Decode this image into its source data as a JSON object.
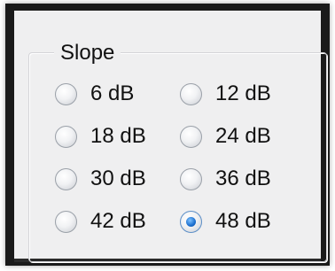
{
  "groupbox": {
    "title": "Slope"
  },
  "options": [
    {
      "label": "6 dB",
      "checked": false
    },
    {
      "label": "12 dB",
      "checked": false
    },
    {
      "label": "18 dB",
      "checked": false
    },
    {
      "label": "24 dB",
      "checked": false
    },
    {
      "label": "30 dB",
      "checked": false
    },
    {
      "label": "36 dB",
      "checked": false
    },
    {
      "label": "42 dB",
      "checked": false
    },
    {
      "label": "48 dB",
      "checked": true
    }
  ],
  "colors": {
    "panel_background": "#efeff0",
    "radio_selected": "#1b6fcf",
    "text": "#111111"
  }
}
